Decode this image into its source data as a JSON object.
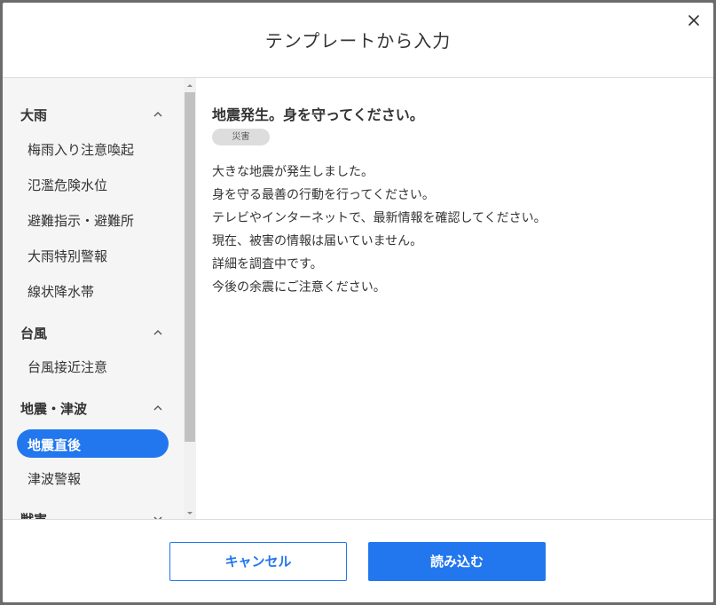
{
  "modal": {
    "title": "テンプレートから入力",
    "close_icon": "close-icon"
  },
  "sidebar": {
    "groups": [
      {
        "label": "大雨",
        "expanded": true,
        "items": [
          {
            "label": "梅雨入り注意喚起",
            "active": false
          },
          {
            "label": "氾濫危険水位",
            "active": false
          },
          {
            "label": "避難指示・避難所",
            "active": false
          },
          {
            "label": "大雨特別警報",
            "active": false
          },
          {
            "label": "線状降水帯",
            "active": false
          }
        ]
      },
      {
        "label": "台風",
        "expanded": true,
        "items": [
          {
            "label": "台風接近注意",
            "active": false
          }
        ]
      },
      {
        "label": "地震・津波",
        "expanded": true,
        "items": [
          {
            "label": "地震直後",
            "active": true
          },
          {
            "label": "津波警報",
            "active": false
          }
        ]
      },
      {
        "label": "獣害",
        "expanded": false,
        "items": []
      }
    ]
  },
  "content": {
    "title": "地震発生。身を守ってください。",
    "tag": "災害",
    "message_lines": [
      "大きな地震が発生しました。",
      "身を守る最善の行動を行ってください。",
      "テレビやインターネットで、最新情報を確認してください。",
      "現在、被害の情報は届いていません。",
      "詳細を調査中です。",
      "今後の余震にご注意ください。"
    ]
  },
  "footer": {
    "cancel_label": "キャンセル",
    "load_label": "読み込む"
  },
  "colors": {
    "accent": "#2277ee",
    "sidebar_bg": "#f5f5f5",
    "overlay": "#6b6b6b"
  }
}
